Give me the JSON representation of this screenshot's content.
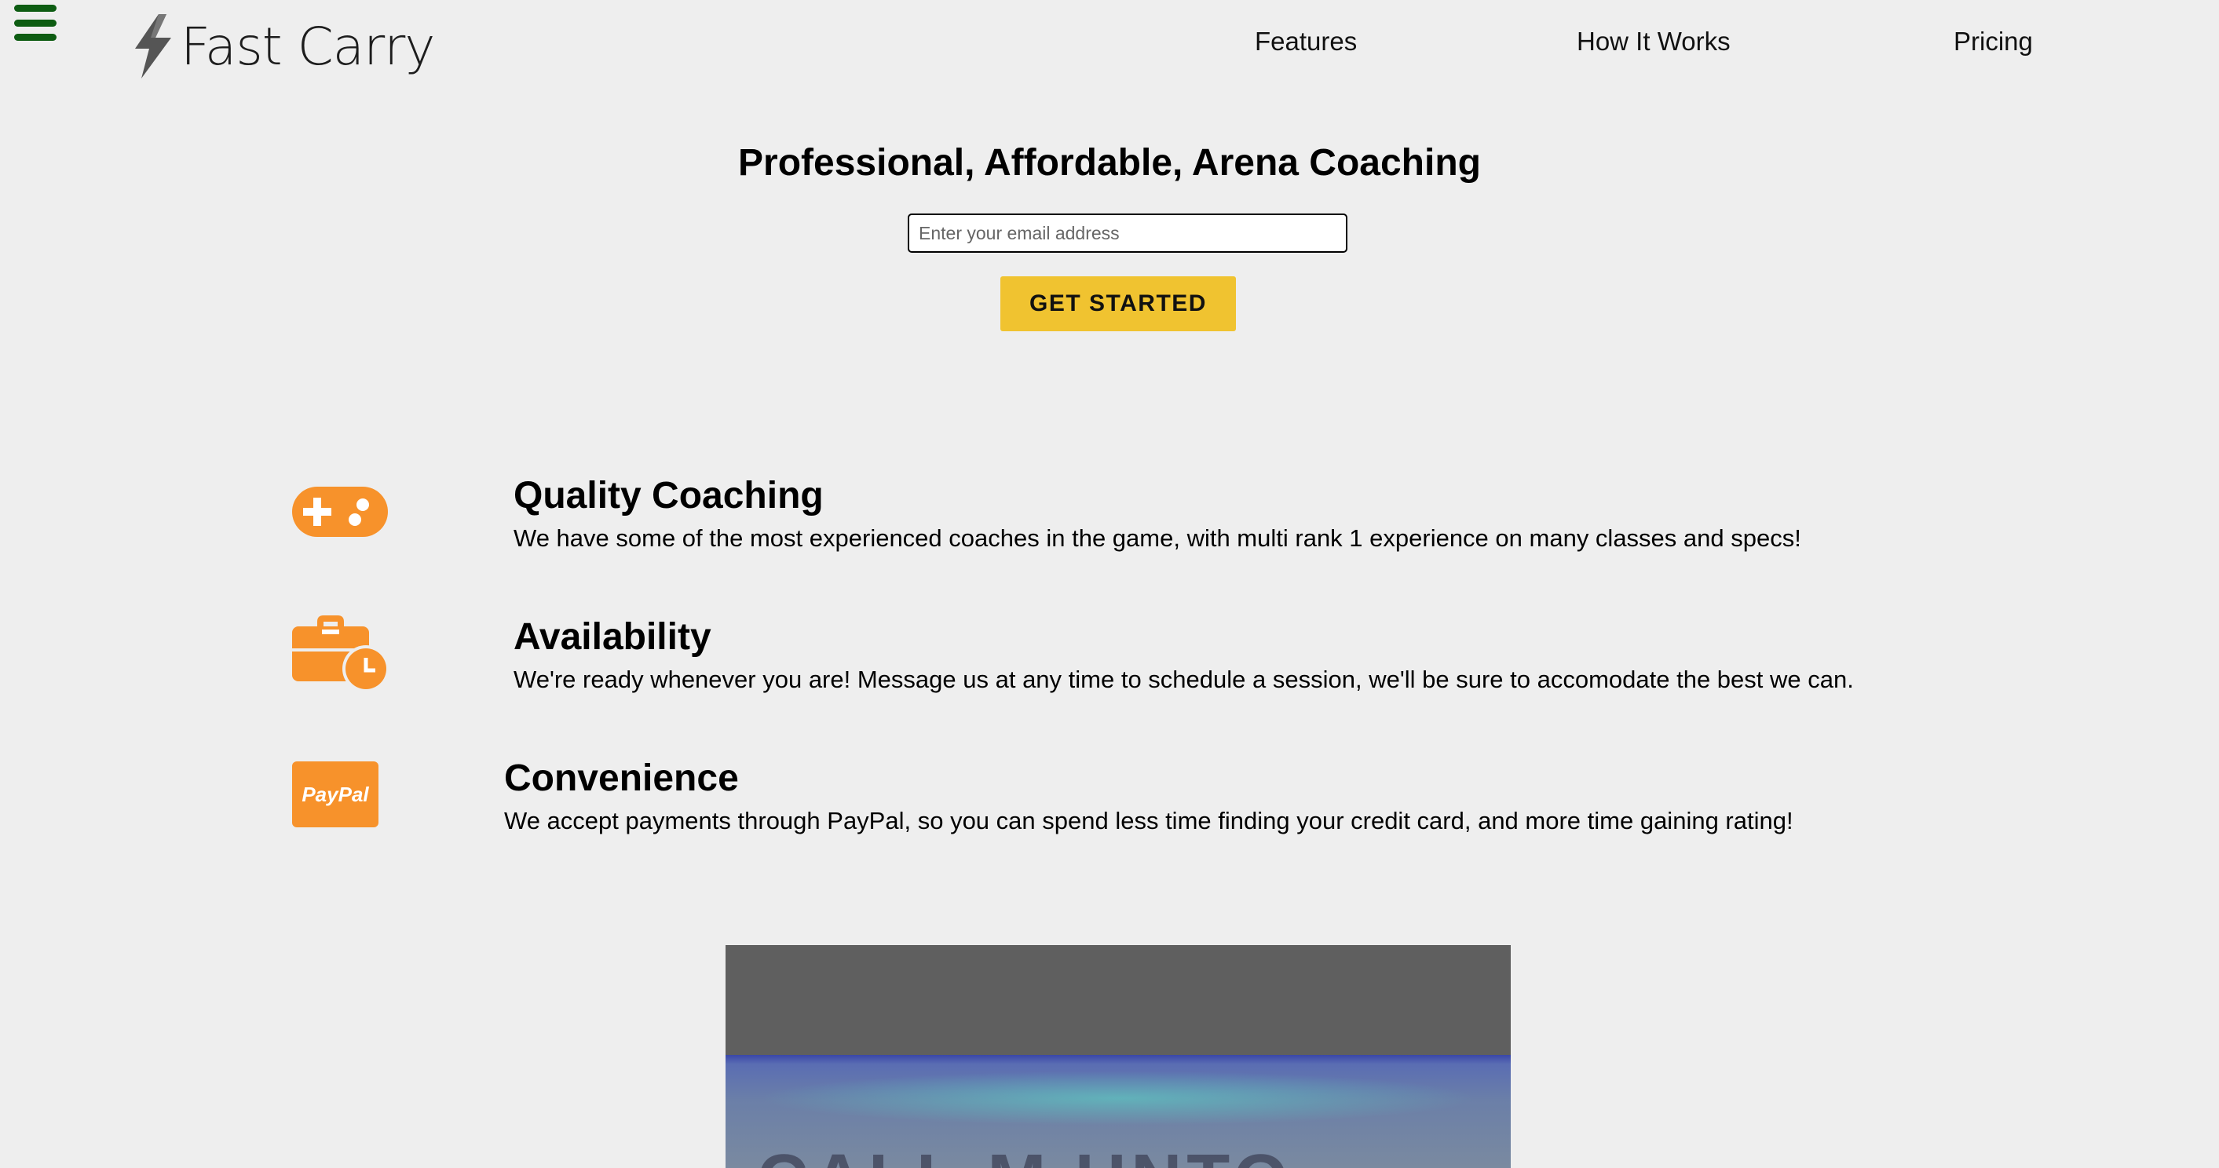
{
  "header": {
    "menu_icon": "hamburger-menu-icon",
    "logo_icon": "lightning-bolt-icon",
    "logo_text": "Fast Carry",
    "nav": [
      {
        "label": "Features"
      },
      {
        "label": "How It Works"
      },
      {
        "label": "Pricing"
      }
    ]
  },
  "hero": {
    "title": "Professional, Affordable, Arena Coaching",
    "email_placeholder": "Enter your email address",
    "email_value": "",
    "cta_label": "GET STARTED"
  },
  "features": [
    {
      "icon": "gamepad-icon",
      "title": "Quality Coaching",
      "description": "We have some of the most experienced coaches in the game, with multi rank 1 experience on many classes and specs!"
    },
    {
      "icon": "briefcase-clock-icon",
      "title": "Availability",
      "description": "We're ready whenever you are! Message us at any time to schedule a session, we'll be sure to accomodate the best we can."
    },
    {
      "icon": "paypal-icon",
      "icon_text": "PayPal",
      "title": "Convenience",
      "description": "We accept payments through PayPal, so you can spend less time finding your credit card, and more time gaining rating!"
    }
  ],
  "video": {
    "overlay_text": "CALL M    UNTO"
  },
  "colors": {
    "background": "#eeeeee",
    "accent_orange": "#f7922b",
    "cta_yellow": "#f0c330",
    "menu_green": "#0d5c12"
  }
}
